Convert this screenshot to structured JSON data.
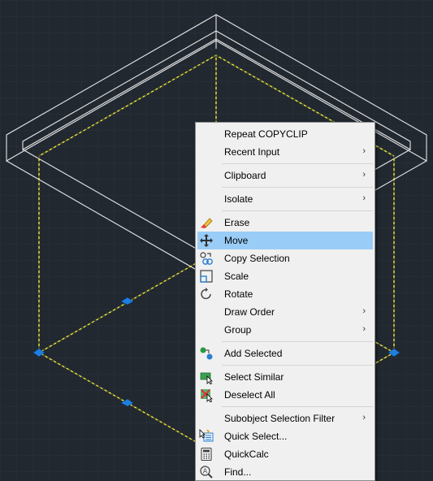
{
  "viewport": {
    "background": "#212830",
    "wireframe_color": "#ffffff",
    "selection_color": "#f0f040",
    "grip_color": "#1f7fe0"
  },
  "context_menu": {
    "repeat": "Repeat COPYCLIP",
    "recent_input": "Recent Input",
    "clipboard": "Clipboard",
    "isolate": "Isolate",
    "erase": "Erase",
    "move": "Move",
    "copy_selection": "Copy Selection",
    "scale": "Scale",
    "rotate": "Rotate",
    "draw_order": "Draw Order",
    "group": "Group",
    "add_selected": "Add Selected",
    "select_similar": "Select Similar",
    "deselect_all": "Deselect All",
    "subobject_filter": "Subobject Selection Filter",
    "quick_select": "Quick Select...",
    "quickcalc": "QuickCalc",
    "find": "Find...",
    "submenu_arrow": "›",
    "highlighted_item": "Move",
    "highlight_color": "#99ccf7"
  }
}
